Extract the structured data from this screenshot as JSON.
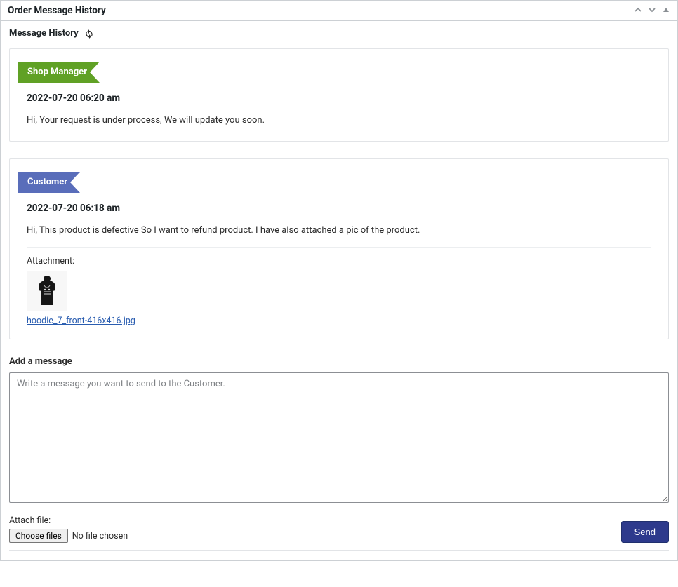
{
  "panel": {
    "title": "Order Message History"
  },
  "subheader": "Message History",
  "messages": [
    {
      "role": "Shop Manager",
      "role_color": "green",
      "timestamp": "2022-07-20 06:20 am",
      "body": "Hi, Your request is under process, We will update you soon.",
      "attachment": null
    },
    {
      "role": "Customer",
      "role_color": "blue",
      "timestamp": "2022-07-20 06:18 am",
      "body": "Hi, This product is defective So I want to refund product. I have also attached a pic of the product.",
      "attachment_label": "Attachment:",
      "attachment_filename": "hoodie_7_front-416x416.jpg"
    }
  ],
  "compose": {
    "title": "Add a message",
    "placeholder": "Write a message you want to send to the Customer.",
    "attach_label": "Attach file:",
    "choose_button": "Choose files",
    "no_file_text": "No file chosen",
    "send_button": "Send"
  }
}
